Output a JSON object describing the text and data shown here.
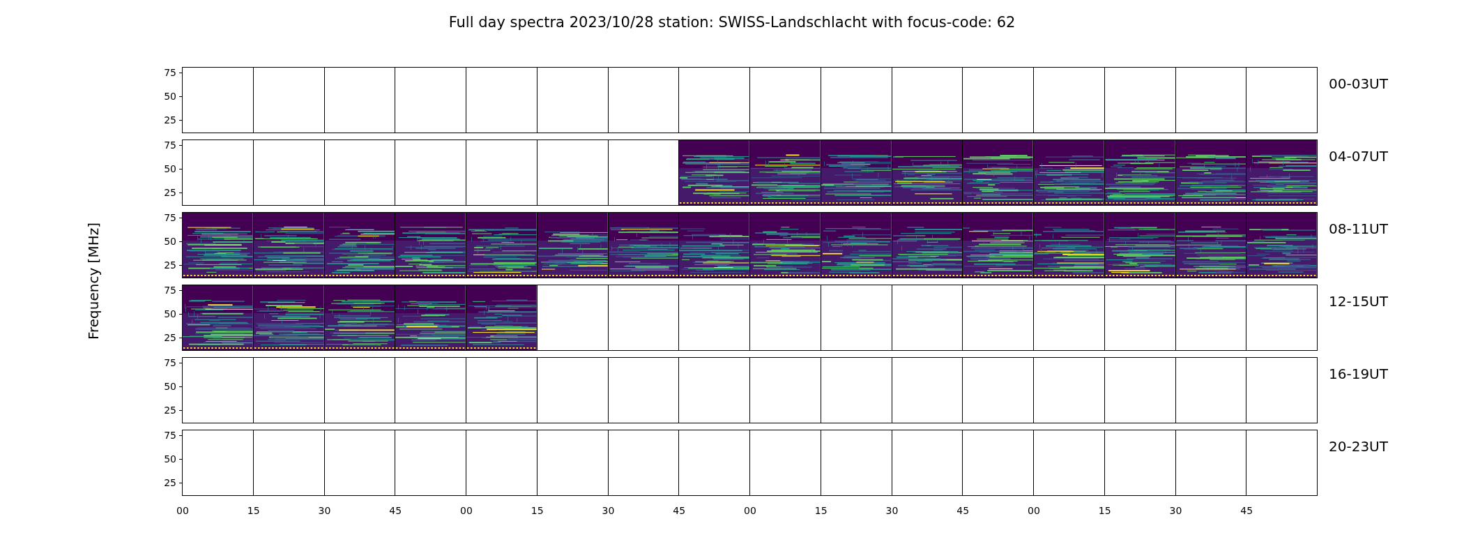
{
  "title": "Full day spectra 2023/10/28 station: SWISS-Landschlacht with focus-code: 62",
  "ylabel": "Frequency [MHz]",
  "xticks": [
    "00",
    "15",
    "30",
    "45",
    "00",
    "15",
    "30",
    "45",
    "00",
    "15",
    "30",
    "45",
    "00",
    "15",
    "30",
    "45"
  ],
  "rows": [
    {
      "label": "00-03UT",
      "yticks": [
        "75",
        "50",
        "25"
      ],
      "panels": [
        false,
        false,
        false,
        false,
        false,
        false,
        false,
        false,
        false,
        false,
        false,
        false,
        false,
        false,
        false,
        false
      ]
    },
    {
      "label": "04-07UT",
      "yticks": [
        "75",
        "50",
        "25"
      ],
      "panels": [
        false,
        false,
        false,
        false,
        false,
        false,
        false,
        true,
        true,
        true,
        true,
        true,
        true,
        true,
        true,
        true
      ]
    },
    {
      "label": "08-11UT",
      "yticks": [
        "75",
        "50",
        "25"
      ],
      "panels": [
        true,
        true,
        true,
        true,
        true,
        true,
        true,
        true,
        true,
        true,
        true,
        true,
        true,
        true,
        true,
        true
      ]
    },
    {
      "label": "12-15UT",
      "yticks": [
        "75",
        "50",
        "25"
      ],
      "panels": [
        true,
        true,
        true,
        true,
        true,
        false,
        false,
        false,
        false,
        false,
        false,
        false,
        false,
        false,
        false,
        false
      ]
    },
    {
      "label": "16-19UT",
      "yticks": [
        "75",
        "50",
        "25"
      ],
      "panels": [
        false,
        false,
        false,
        false,
        false,
        false,
        false,
        false,
        false,
        false,
        false,
        false,
        false,
        false,
        false,
        false
      ]
    },
    {
      "label": "20-23UT",
      "yticks": [
        "75",
        "50",
        "25"
      ],
      "panels": [
        false,
        false,
        false,
        false,
        false,
        false,
        false,
        false,
        false,
        false,
        false,
        false,
        false,
        false,
        false,
        false
      ]
    }
  ]
}
